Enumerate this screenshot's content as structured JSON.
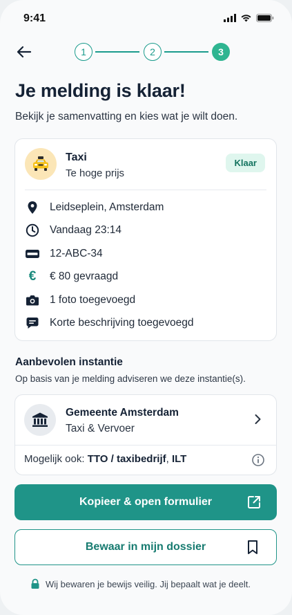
{
  "status_bar": {
    "time": "9:41"
  },
  "stepper": {
    "steps": [
      "1",
      "2",
      "3"
    ],
    "active_step": 3
  },
  "header": {
    "title": "Je melding is klaar!",
    "subtitle": "Bekijk je samenvatting en kies wat je wilt doen."
  },
  "summary": {
    "category_title": "Taxi",
    "category_subtitle": "Te hoge prijs",
    "badge": "Klaar",
    "details": [
      {
        "icon": "location-pin-icon",
        "text": "Leidseplein, Amsterdam"
      },
      {
        "icon": "clock-icon",
        "text": "Vandaag 23:14"
      },
      {
        "icon": "license-plate-icon",
        "text": "12-ABC-34"
      },
      {
        "icon": "euro-icon",
        "text": "€ 80 gevraagd"
      },
      {
        "icon": "camera-icon",
        "text": "1 foto toegevoegd"
      },
      {
        "icon": "chat-bubble-icon",
        "text": "Korte beschrijving toegevoegd"
      }
    ]
  },
  "recommendation": {
    "title": "Aanbevolen instantie",
    "subtitle": "Op basis van je melding adviseren we deze instantie(s).",
    "institution_name": "Gemeente Amsterdam",
    "institution_dept": "Taxi & Vervoer",
    "also_prefix": "Mogelijk ook: ",
    "also_item_1": "TTO / taxibedrijf",
    "also_separator": ", ",
    "also_item_2": "ILT"
  },
  "actions": {
    "primary_label": "Kopieer & open formulier",
    "secondary_label": "Bewaar in mijn dossier"
  },
  "footer": {
    "note": "Wij bewaren je bewijs veilig. Jij bepaalt wat je deelt."
  },
  "colors": {
    "accent": "#1f9488",
    "step_active": "#2fb591",
    "badge_bg": "#dff6ee",
    "badge_text": "#13735f",
    "euro_icon": "#1a8a7c"
  }
}
